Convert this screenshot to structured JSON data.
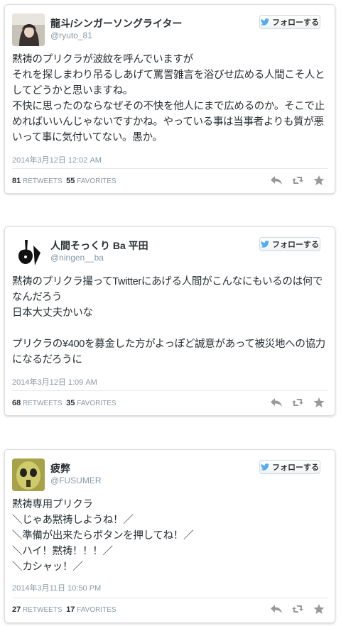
{
  "tweets": [
    {
      "name": "龍斗/シンガーソングライター",
      "handle": "@ryuto_81",
      "follow_label": "フォローする",
      "text": "黙祷のプリクラが波紋を呼んでいますが\nそれを探しまわり吊るしあげて罵詈雑言を浴びせ広める人間こそ人としてどうかと思いますね。\n不快に思ったのならなぜその不快を他人にまで広めるのか。そこで止めればいいんじゃないですかね。やっている事は当事者よりも質が悪いって事に気付いてない。愚か。",
      "timestamp": "2014年3月12日 12:02 AM",
      "retweets": "81",
      "retweets_label": "RETWEETS",
      "favorites": "55",
      "favorites_label": "FAVORITES"
    },
    {
      "name": "人間そっくり Ba 平田",
      "handle": "@ningen__ba",
      "follow_label": "フォローする",
      "text": "黙祷のプリクラ撮ってTwitterにあげる人間がこんなにもいるのは何でなんだろう\n日本大丈夫かいな\n\nプリクラの¥400を募金した方がよっぽど誠意があって被災地への協力になるだろうに",
      "timestamp": "2014年3月12日 1:09 AM",
      "retweets": "68",
      "retweets_label": "RETWEETS",
      "favorites": "35",
      "favorites_label": "FAVORITES"
    },
    {
      "name": "疲弊",
      "handle": "@FUSUMER",
      "follow_label": "フォローする",
      "text": "黙祷専用プリクラ\n＼じゃあ黙祷しようね！／\n＼準備が出来たらボタンを押してね！／\n＼ハイ！黙祷！！！／\n＼カシャッ！／",
      "timestamp": "2014年3月11日 10:50 PM",
      "retweets": "27",
      "retweets_label": "RETWEETS",
      "favorites": "17",
      "favorites_label": "FAVORITES"
    }
  ],
  "icons": {
    "bird": "twitter-bird-icon",
    "reply": "reply-icon",
    "retweet": "retweet-icon",
    "favorite": "star-icon"
  },
  "colors": {
    "bird": "#55acee",
    "text": "#292f33",
    "muted": "#8899a6",
    "action_icon": "#999999"
  }
}
